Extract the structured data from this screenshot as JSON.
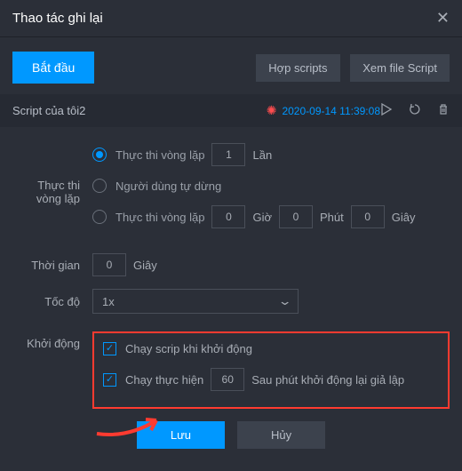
{
  "header": {
    "title": "Thao tác ghi lại"
  },
  "toolbar": {
    "start": "Bắt đầu",
    "merge": "Hợp scripts",
    "view": "Xem file Script"
  },
  "script": {
    "name": "Script của tôi2",
    "date": "2020-09-14 11:39:08"
  },
  "loop": {
    "label": "Thực thi vòng lặp",
    "opt1": "Thực thi vòng lặp",
    "opt1_val": "1",
    "opt1_suffix": "Lần",
    "opt2": "Người dùng tự dừng",
    "opt3": "Thực thi vòng lặp",
    "opt3_h": "0",
    "opt3_h_lbl": "Giờ",
    "opt3_m": "0",
    "opt3_m_lbl": "Phút",
    "opt3_s": "0",
    "opt3_s_lbl": "Giây"
  },
  "time": {
    "label": "Thời gian",
    "val": "0",
    "unit": "Giây"
  },
  "speed": {
    "label": "Tốc độ",
    "val": "1x"
  },
  "startup": {
    "label": "Khởi động",
    "chk1": "Chạy scrip khi khởi động",
    "chk2_pre": "Chạy thực hiện",
    "chk2_val": "60",
    "chk2_post": "Sau phút khởi động lại giả lập"
  },
  "footer": {
    "save": "Lưu",
    "cancel": "Hủy"
  }
}
